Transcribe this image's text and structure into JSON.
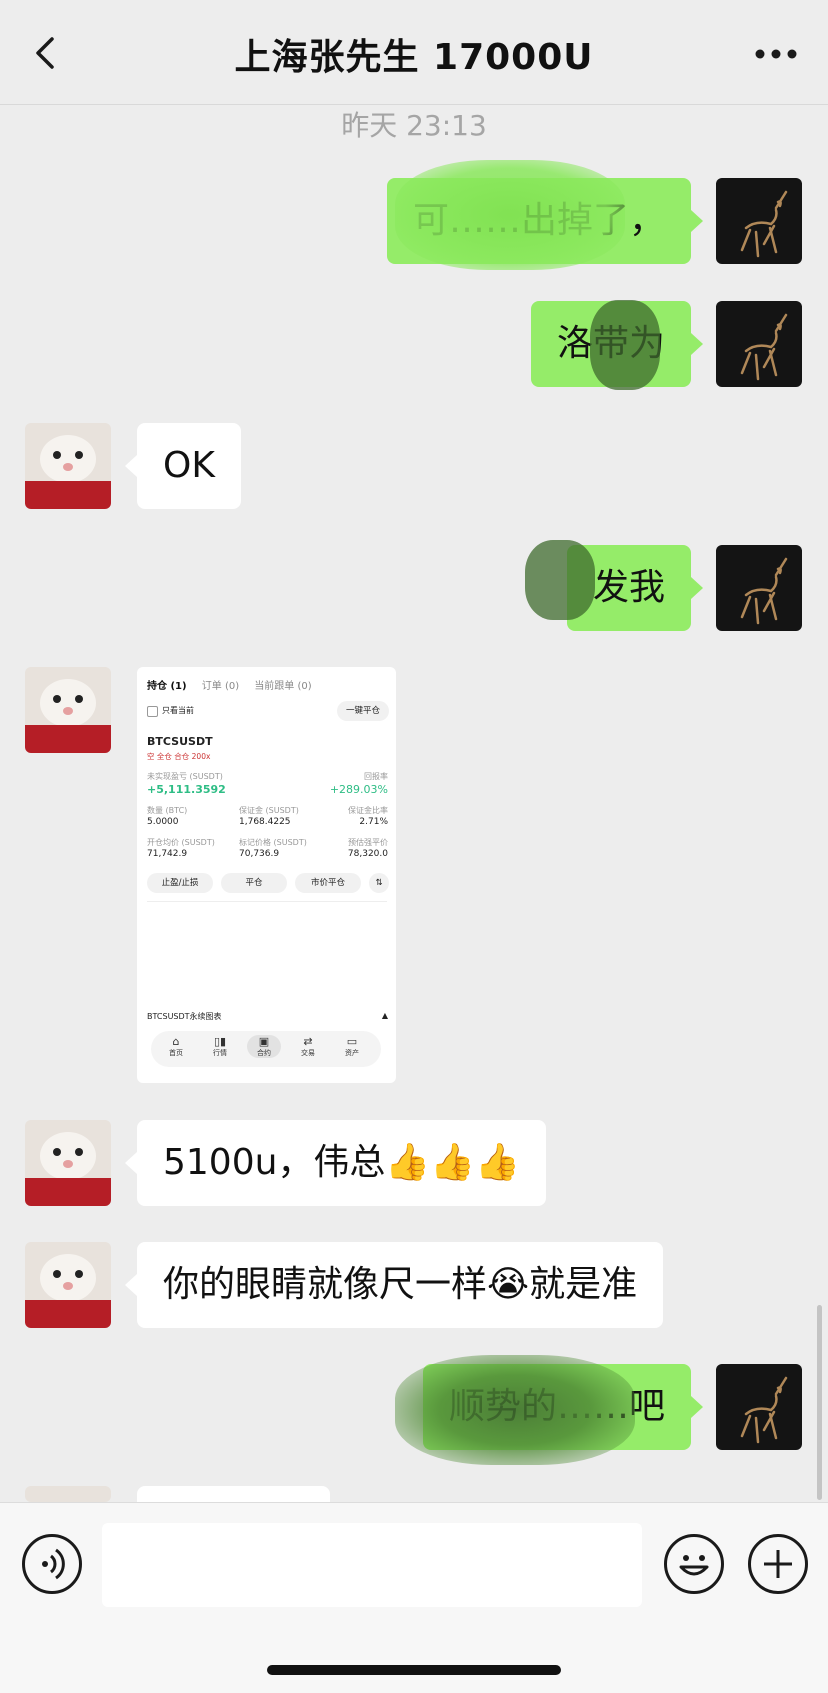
{
  "header": {
    "title": "上海张先生 17000U"
  },
  "timestamp": "昨天 23:13",
  "messages": [
    {
      "side": "right",
      "text": "可……出掉了，"
    },
    {
      "side": "right",
      "text": "洛带为"
    },
    {
      "side": "left",
      "text": "OK"
    },
    {
      "side": "right",
      "text": "发我"
    },
    {
      "side": "left",
      "type": "image"
    },
    {
      "side": "left",
      "text": "5100u，伟总👍👍👍"
    },
    {
      "side": "left",
      "text": "你的眼睛就像尺一样😭就是准"
    },
    {
      "side": "right",
      "text": "顺势的……吧"
    }
  ],
  "screenshot": {
    "tab_positions": "持仓 (1)",
    "tab_orders": "订单 (0)",
    "tab_follow": "当前跟单 (0)",
    "only_current": "只看当前",
    "close_all": "一键平仓",
    "symbol": "BTCSUSDT",
    "tags": "空  全仓 合仓   200x",
    "unrealized_label": "未实现盈亏 (SUSDT)",
    "unrealized_value": "+5,111.3592",
    "roe_label": "回报率",
    "roe_value": "+289.03%",
    "qty_label": "数量 (BTC)",
    "qty_value": "5.0000",
    "margin_label": "保证金 (SUSDT)",
    "margin_value": "1,768.4225",
    "margin_ratio_label": "保证金比率",
    "margin_ratio_value": "2.71%",
    "entry_label": "开仓均价 (SUSDT)",
    "entry_value": "71,742.9",
    "mark_label": "标记价格 (SUSDT)",
    "mark_value": "70,736.9",
    "liq_label": "预估强平价",
    "liq_value": "78,320.0",
    "btn_tpsl": "止盈/止损",
    "btn_close": "平仓",
    "btn_market_close": "市价平仓",
    "chart_label": "BTCSUSDT永续图表",
    "nav": [
      "首页",
      "行情",
      "合约",
      "交易",
      "资产"
    ]
  },
  "colors": {
    "green_bubble": "#95ec69",
    "profit_green": "#2ebd85",
    "background": "#ededed"
  },
  "icons": [
    "back-arrow-icon",
    "more-dots-icon",
    "voice-icon",
    "emoji-icon",
    "plus-icon"
  ]
}
